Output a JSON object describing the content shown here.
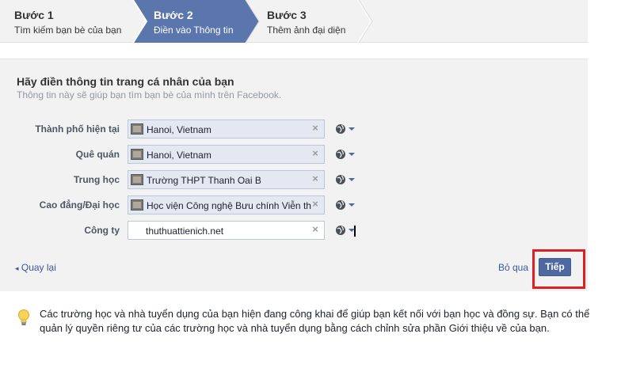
{
  "steps": [
    {
      "title": "Bước 1",
      "desc": "Tìm kiếm bạn bè của bạn",
      "active": false
    },
    {
      "title": "Bước 2",
      "desc": "Điền vào Thông tin",
      "active": true
    },
    {
      "title": "Bước 3",
      "desc": "Thêm ảnh đại diện",
      "active": false
    }
  ],
  "panel": {
    "title": "Hãy điền thông tin trang cá nhân của bạn",
    "subtitle": "Thông tin này sẽ giúp bạn tìm bạn bè của mình trên Facebook."
  },
  "fields": [
    {
      "label": "Thành phố hiện tại",
      "value": "Hanoi, Vietnam"
    },
    {
      "label": "Quê quán",
      "value": "Hanoi, Vietnam"
    },
    {
      "label": "Trung học",
      "value": "Trường THPT Thanh Oai B"
    },
    {
      "label": "Cao đẳng/Đại học",
      "value": "Học viện Công nghệ Bưu chính Viễn thông"
    },
    {
      "label": "Công ty",
      "value": "thuthuattienich.net"
    }
  ],
  "actions": {
    "back": "Quay lại",
    "skip": "Bỏ qua",
    "next": "Tiếp"
  },
  "notice": "Các trường học và nhà tuyển dụng của bạn hiện đang công khai để giúp bạn kết nối với bạn học và đồng sự. Bạn có thể quản lý quyền riêng tư của các trường học và nhà tuyển dụng bằng cách chỉnh sửa phần Giới thiệu về của bạn.",
  "colors": {
    "active_step": "#5b76ad",
    "link": "#3b5998",
    "button": "#4e69a2",
    "highlight": "#e02020"
  },
  "icons": {
    "privacy": "globe-icon",
    "clear": "close-icon",
    "notice": "lightbulb-icon",
    "back": "chevron-left-icon"
  }
}
